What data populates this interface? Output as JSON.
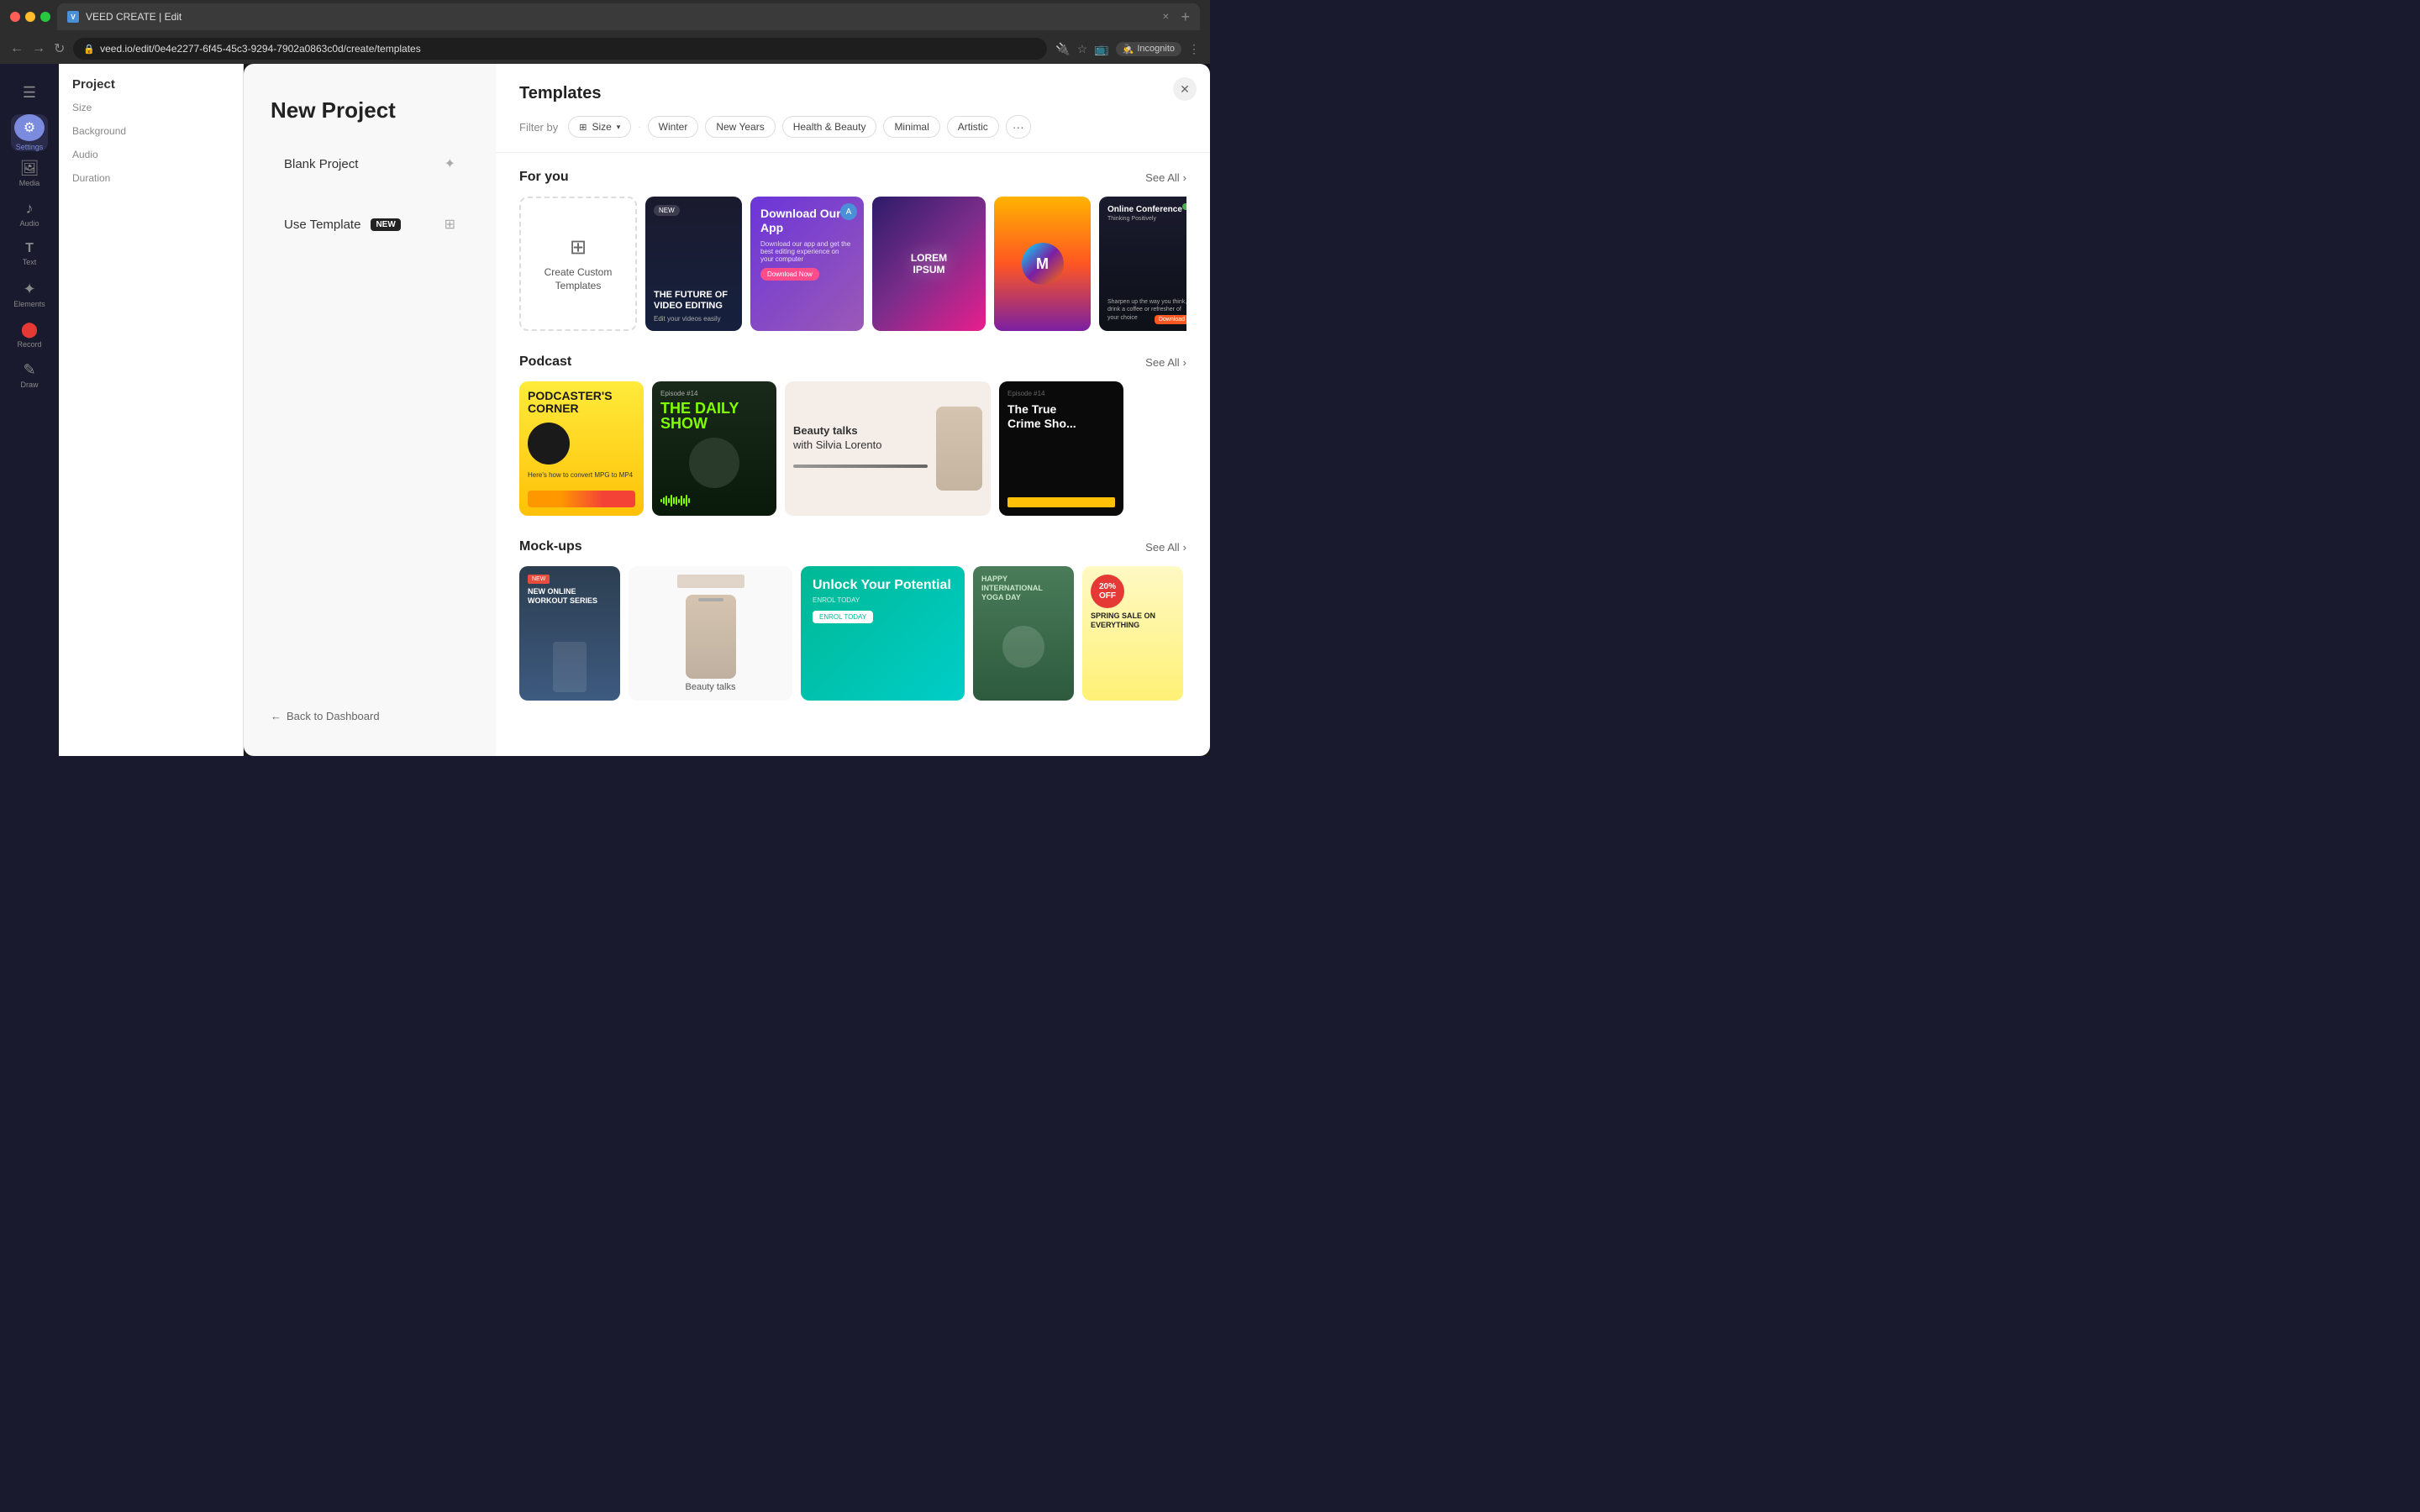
{
  "browser": {
    "tab_title": "VEED CREATE | Edit",
    "url": "veed.io/edit/0e4e2277-6f45-45c3-9294-7902a0863c0d/create/templates",
    "incognito_label": "Incognito"
  },
  "sidebar": {
    "items": [
      {
        "label": "Settings",
        "icon": "⚙",
        "active": true
      },
      {
        "label": "Media",
        "icon": "🖼",
        "active": false
      },
      {
        "label": "Audio",
        "icon": "🎵",
        "active": false
      },
      {
        "label": "Text",
        "icon": "T",
        "active": false
      },
      {
        "label": "Elements",
        "icon": "✦",
        "active": false
      },
      {
        "label": "Record",
        "icon": "⬤",
        "active": false
      },
      {
        "label": "Draw",
        "icon": "✎",
        "active": false
      }
    ]
  },
  "settings": {
    "title": "Project",
    "size_label": "Size",
    "background_label": "Background",
    "audio_label": "Audio",
    "duration_label": "Duration"
  },
  "modal": {
    "new_project_title": "New Project",
    "blank_project_label": "Blank Project",
    "use_template_label": "Use Template",
    "use_template_badge": "NEW",
    "back_label": "Back to Dashboard",
    "close_icon": "✕"
  },
  "templates": {
    "title": "Templates",
    "filter_label": "Filter by",
    "size_chip": "Size",
    "filters": [
      "Winter",
      "New Years",
      "Health & Beauty",
      "Minimal",
      "Artistic"
    ],
    "more_icon": "···",
    "sections": [
      {
        "title": "For you",
        "see_all": "See All",
        "cards": [
          {
            "type": "create-custom",
            "label": "Create Custom Templates"
          },
          {
            "type": "future",
            "title": "THE FUTURE OF VIDEO EDITING"
          },
          {
            "type": "download",
            "title": "Download Our App"
          },
          {
            "type": "lorem",
            "title": "LOREM IPSUM"
          },
          {
            "type": "colorful",
            "title": ""
          },
          {
            "type": "online",
            "title": "Online Conference"
          }
        ]
      },
      {
        "title": "Podcast",
        "see_all": "See All",
        "cards": [
          {
            "type": "podcaster",
            "title": "PODCASTER'S CORNER"
          },
          {
            "type": "daily",
            "title": "THE DAILY SHOW",
            "ep": "Episode #14"
          },
          {
            "type": "beauty-talks",
            "title": "Beauty talks with Silvia Lorento"
          },
          {
            "type": "true-crime",
            "title": "The True Crime Show",
            "ep": "Episode #14"
          }
        ]
      },
      {
        "title": "Mock-ups",
        "see_all": "See All",
        "cards": [
          {
            "type": "workout",
            "title": "NEW ONLINE WORKOUT SERIES"
          },
          {
            "type": "beauty-mockup",
            "title": "Beauty talks"
          },
          {
            "type": "unlock",
            "title": "Unlock Your Potential"
          },
          {
            "type": "yoga",
            "title": "Happy International YOGA DAY"
          },
          {
            "type": "spring",
            "title": "SPRING SALE ON EVERYTHING"
          }
        ]
      }
    ]
  }
}
